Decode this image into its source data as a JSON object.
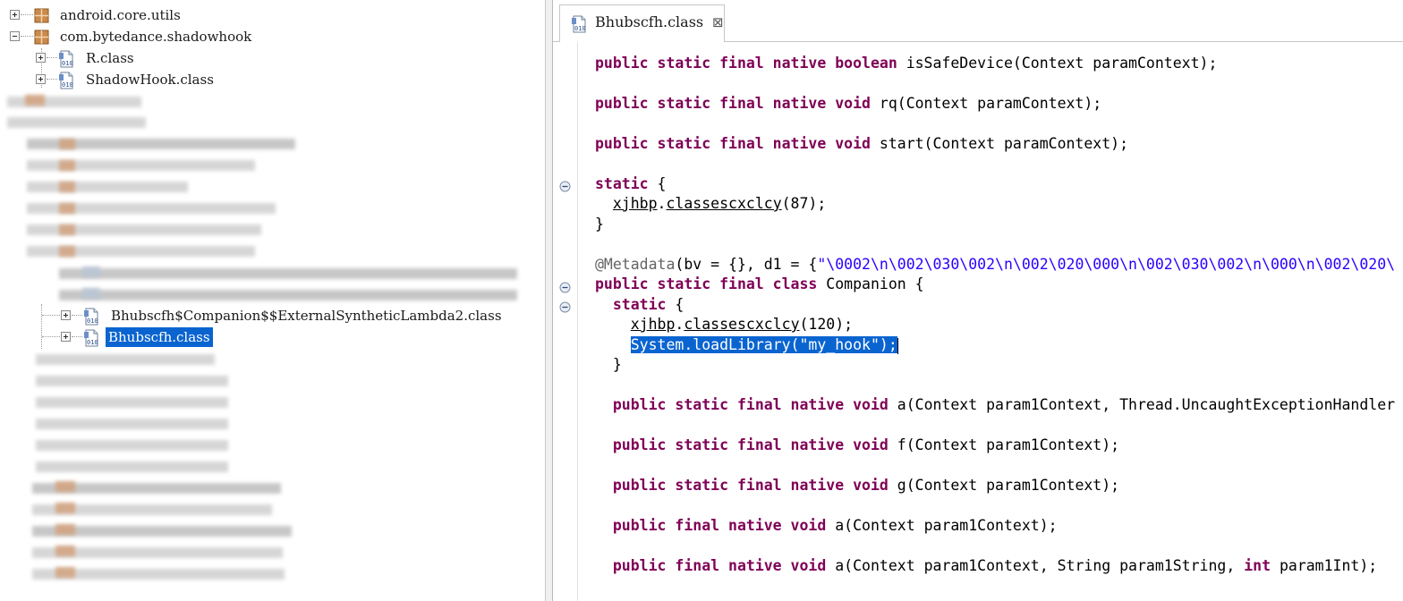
{
  "tree": {
    "packages": [
      {
        "label": "android.core.utils"
      },
      {
        "label": "com.bytedance.shadowhook"
      }
    ],
    "classes": [
      {
        "label": "R.class"
      },
      {
        "label": "ShadowHook.class"
      }
    ],
    "lower_items": [
      {
        "label": "Bhubscfh$Companion$$ExternalSyntheticLambda2.class"
      },
      {
        "label": "Bhubscfh.class",
        "selected": true
      }
    ]
  },
  "editor": {
    "tab": {
      "label": "Bhubscfh.class",
      "close": "⊠"
    },
    "code": {
      "l1_kw": "public static final native boolean ",
      "l1_rest": "isSafeDevice(Context paramContext);",
      "l2_kw": "public static final native void ",
      "l2_rest": "rq(Context paramContext);",
      "l3_kw": "public static final native void ",
      "l3_rest": "start(Context paramContext);",
      "l4_kw": "static",
      "l4_rest": " {",
      "l5_pre": "  ",
      "l5_obj": "xjhbp",
      "l5_dot": ".",
      "l5_method": "classescxclcy",
      "l5_rest": "(87);",
      "l6": "}",
      "l7_ann": "@Metadata",
      "l7_mid": "(bv = {}, d1 = {",
      "l7_str": "\"\\0002\\n\\002\\030\\002\\n\\002\\020\\000\\n\\002\\030\\002\\n\\000\\n\\002\\020\\",
      "l8_kw": "public static final class ",
      "l8_rest": "Companion {",
      "l9_pre": "  ",
      "l9_kw": "static",
      "l9_rest": " {",
      "l10_pre": "    ",
      "l10_obj": "xjhbp",
      "l10_dot": ".",
      "l10_method": "classescxclcy",
      "l10_rest": "(120);",
      "l11_pre": "    ",
      "l11_sel": "System.loadLibrary(\"my_hook\");",
      "l12": "  }",
      "l13_pre": "  ",
      "l13_kw": "public static final native void ",
      "l13_rest": "a(Context param1Context, Thread.UncaughtExceptionHandler",
      "l14_pre": "  ",
      "l14_kw": "public static final native void ",
      "l14_rest": "f(Context param1Context);",
      "l15_pre": "  ",
      "l15_kw": "public static final native void ",
      "l15_rest": "g(Context param1Context);",
      "l16_pre": "  ",
      "l16_kw": "public final native void ",
      "l16_rest": "a(Context param1Context);",
      "l17_pre": "  ",
      "l17_kw": "public final native void ",
      "l17_rest1": "a(Context param1Context, String param1String, ",
      "l17_kw2": "int",
      "l17_rest2": " param1Int);"
    }
  }
}
